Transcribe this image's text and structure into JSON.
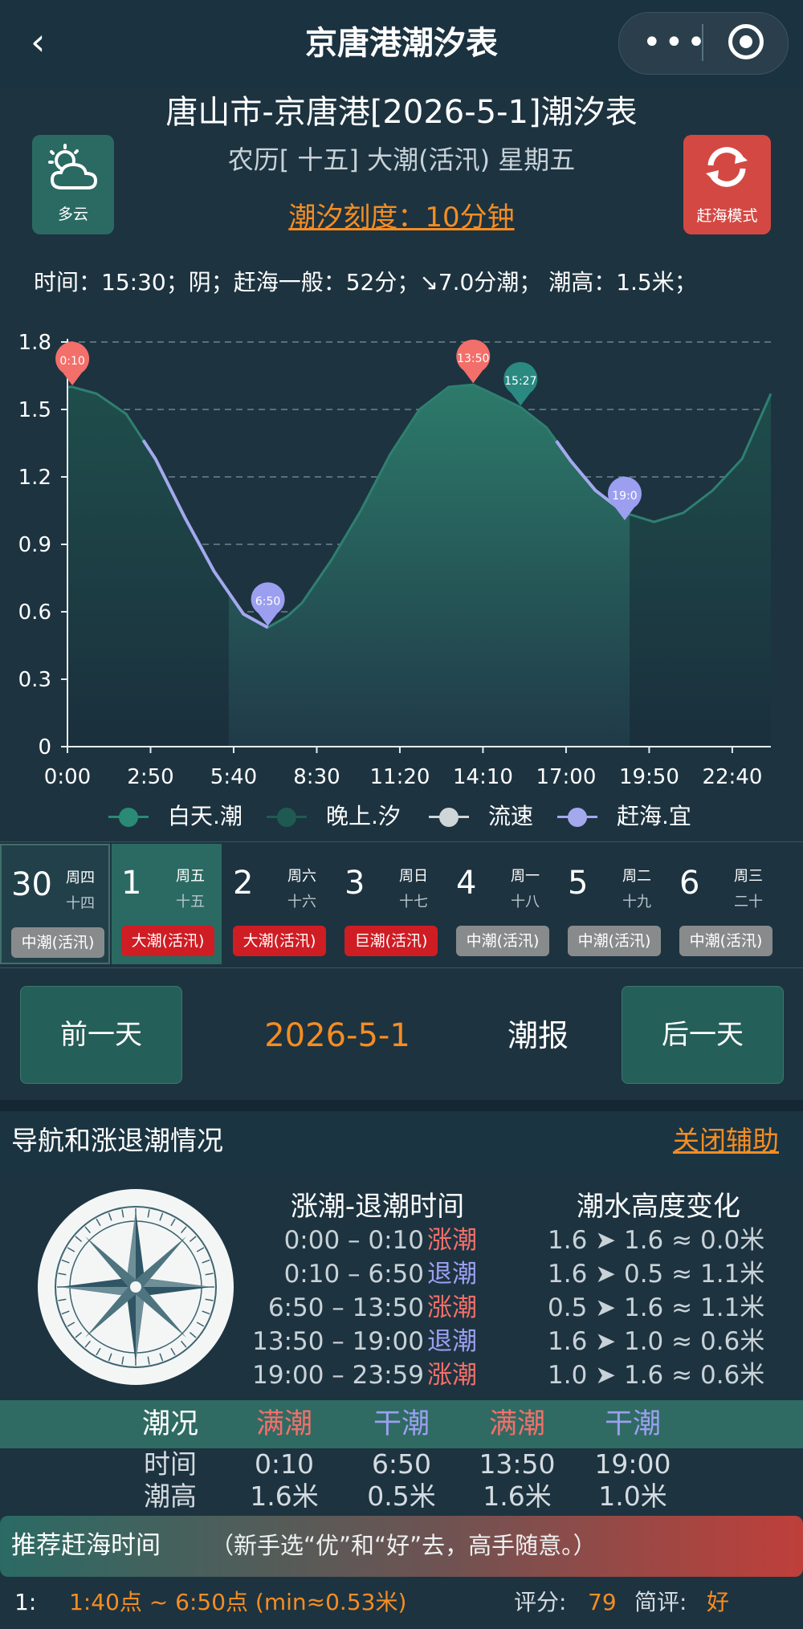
{
  "nav": {
    "title": "京唐港潮汐表",
    "back_icon": "‹",
    "more_icon": "•••"
  },
  "header": {
    "title": "唐山市-京唐港[2026-5-1]潮汐表",
    "lunar": "农历[ 十五] 大潮(活汛) 星期五",
    "scale": "潮汐刻度：10分钟",
    "weather_label": "多云",
    "mode_label": "赶海模式"
  },
  "info_line": "时间：15:30；阴；赶海一般：52分；↘7.0分潮； 潮高：1.5米；",
  "chart_data": {
    "type": "area",
    "ylim": [
      0,
      1.8
    ],
    "y_ticks": [
      "0",
      "0.3",
      "0.6",
      "0.9",
      "1.2",
      "1.5",
      "1.8"
    ],
    "x_ticks": [
      "0:00",
      "2:50",
      "5:40",
      "8:30",
      "11:20",
      "14:10",
      "17:00",
      "19:50",
      "22:40"
    ],
    "x_tick_minutes": [
      0,
      170,
      340,
      510,
      680,
      850,
      1020,
      1190,
      1360
    ],
    "x_range_minutes": [
      0,
      1439
    ],
    "series": [
      {
        "name": "白天.潮",
        "color": "#2a8a76"
      },
      {
        "name": "晚上.汐",
        "color": "#1f5a52"
      },
      {
        "name": "流速",
        "color": "#cfd6d8"
      },
      {
        "name": "赶海.宜",
        "color": "#a4a9ee"
      }
    ],
    "points_minutes": [
      0,
      10,
      60,
      120,
      180,
      240,
      300,
      360,
      410,
      450,
      480,
      540,
      600,
      660,
      720,
      780,
      830,
      860,
      927,
      980,
      1030,
      1080,
      1140,
      1200,
      1260,
      1320,
      1380,
      1439
    ],
    "points_values": [
      1.6,
      1.6,
      1.57,
      1.48,
      1.28,
      1.02,
      0.78,
      0.59,
      0.53,
      0.58,
      0.64,
      0.83,
      1.05,
      1.3,
      1.5,
      1.6,
      1.61,
      1.58,
      1.51,
      1.42,
      1.27,
      1.14,
      1.04,
      1.0,
      1.04,
      1.14,
      1.28,
      1.57
    ],
    "day_start_minutes": 330,
    "day_end_minutes": 1150,
    "ganhai_segments": [
      [
        155,
        410
      ],
      [
        1000,
        1140
      ]
    ],
    "markers": [
      {
        "label": "0:10",
        "minute": 10,
        "value": 1.6,
        "color": "#f36f6a"
      },
      {
        "label": "6:50",
        "minute": 410,
        "value": 0.53,
        "color": "#9c9ff0"
      },
      {
        "label": "13:50",
        "minute": 830,
        "value": 1.61,
        "color": "#f36f6a"
      },
      {
        "label": "15:27",
        "minute": 927,
        "value": 1.51,
        "color": "#2a8a82"
      },
      {
        "label": "19:0",
        "minute": 1140,
        "value": 1.0,
        "color": "#9c9ff0"
      }
    ]
  },
  "days": [
    {
      "num": "30",
      "week": "周四",
      "lunar": "十四",
      "tag": "中潮(活汛)",
      "tag_color": "#888b8c",
      "selected": false
    },
    {
      "num": "1",
      "week": "周五",
      "lunar": "十五",
      "tag": "大潮(活汛)",
      "tag_color": "#cf1d24",
      "selected": true
    },
    {
      "num": "2",
      "week": "周六",
      "lunar": "十六",
      "tag": "大潮(活汛)",
      "tag_color": "#cf1d24",
      "selected": false
    },
    {
      "num": "3",
      "week": "周日",
      "lunar": "十七",
      "tag": "巨潮(活汛)",
      "tag_color": "#cf1d24",
      "selected": false
    },
    {
      "num": "4",
      "week": "周一",
      "lunar": "十八",
      "tag": "中潮(活汛)",
      "tag_color": "#888b8c",
      "selected": false
    },
    {
      "num": "5",
      "week": "周二",
      "lunar": "十九",
      "tag": "中潮(活汛)",
      "tag_color": "#888b8c",
      "selected": false
    },
    {
      "num": "6",
      "week": "周三",
      "lunar": "二十",
      "tag": "中潮(活汛)",
      "tag_color": "#888b8c",
      "selected": false
    }
  ],
  "daynav": {
    "prev": "前一天",
    "date": "2026-5-1",
    "report": "潮报",
    "next": "后一天"
  },
  "section": {
    "title": "导航和涨退潮情况",
    "close": "关闭辅助"
  },
  "tide_table": {
    "head_time": "涨潮-退潮时间",
    "head_change": "潮水高度变化",
    "rows": [
      {
        "time": "0:00 – 0:10",
        "state": "涨潮",
        "change": "1.6 ➤ 1.6 ≈ 0.0米"
      },
      {
        "time": "0:10 – 6:50",
        "state": "退潮",
        "change": "1.6 ➤ 0.5 ≈ 1.1米"
      },
      {
        "time": "6:50 – 13:50",
        "state": "涨潮",
        "change": "0.5 ➤ 1.6 ≈ 1.1米"
      },
      {
        "time": "13:50 – 19:00",
        "state": "退潮",
        "change": "1.6 ➤ 1.0 ≈ 0.6米"
      },
      {
        "time": "19:00 – 23:59",
        "state": "涨潮",
        "change": "1.0 ➤ 1.6 ≈ 0.6米"
      }
    ],
    "rise_color": "#f36f6a",
    "fall_color": "#9c9ff0"
  },
  "state_table": {
    "head": "潮况",
    "time_label": "时间",
    "height_label": "潮高",
    "cols": [
      {
        "state": "满潮",
        "time": "0:10",
        "height": "1.6米"
      },
      {
        "state": "干潮",
        "time": "6:50",
        "height": "0.5米"
      },
      {
        "state": "满潮",
        "time": "13:50",
        "height": "1.6米"
      },
      {
        "state": "干潮",
        "time": "19:00",
        "height": "1.0米"
      }
    ]
  },
  "recommend": {
    "title": "推荐赶海时间",
    "note": "（新手选“优”和“好”去，高手随意。）",
    "index": "1:",
    "range": "1:40点 ~ 6:50点 (min≈0.53米)",
    "score_label": "评分:",
    "score": "79",
    "comment_label": "简评:",
    "comment": "好"
  }
}
